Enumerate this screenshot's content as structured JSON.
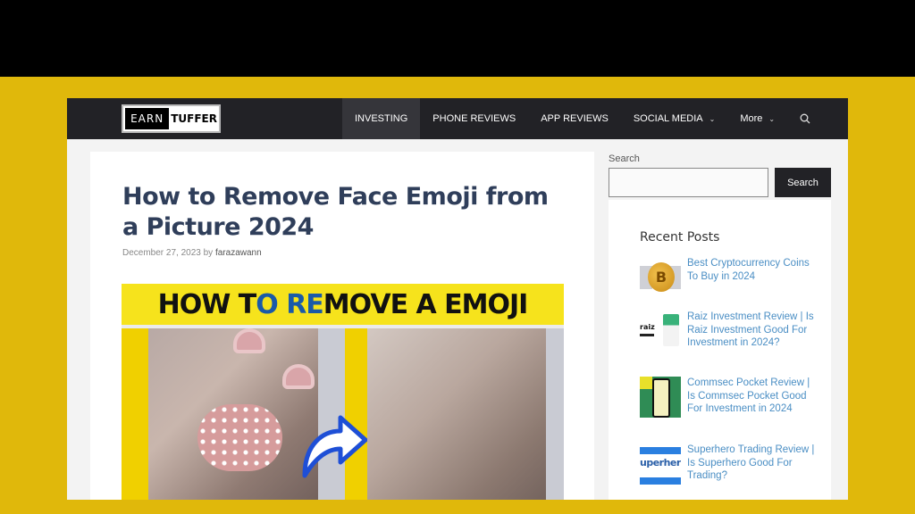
{
  "site": {
    "logo": {
      "part1": "EARN",
      "part2": "TUFFER"
    },
    "nav": [
      {
        "label": "INVESTING",
        "active": true,
        "has_dropdown": false
      },
      {
        "label": "PHONE REVIEWS",
        "active": false,
        "has_dropdown": false
      },
      {
        "label": "APP REVIEWS",
        "active": false,
        "has_dropdown": false
      },
      {
        "label": "SOCIAL MEDIA",
        "active": false,
        "has_dropdown": true
      },
      {
        "label": "More",
        "active": false,
        "has_dropdown": true
      }
    ],
    "nav_search_icon": "search-icon",
    "colors": {
      "header_bg": "#222226",
      "page_frame": "#e0b80b",
      "title": "#2f3e5a",
      "link": "#4a8ec4"
    }
  },
  "article": {
    "title": "How to Remove Face Emoji from a Picture 2024",
    "date": "December 27, 2023",
    "by": "by",
    "author": "farazawann",
    "featured_image": {
      "banner_pre": "HOW T",
      "banner_blue": "O RE",
      "banner_post": "MOVE A EMOJI"
    }
  },
  "sidebar": {
    "search_label": "Search",
    "search_value": "",
    "search_button": "Search",
    "recent_title": "Recent Posts",
    "posts": [
      {
        "title": "Best Cryptocurrency Coins To Buy in 2024",
        "thumb": "bitcoin"
      },
      {
        "title": "Raiz Investment Review | Is Raiz Investment Good For Investment in 2024?",
        "thumb": "raiz"
      },
      {
        "title": "Commsec Pocket Review | Is Commsec Pocket Good For Investment in 2024",
        "thumb": "commsec"
      },
      {
        "title": "Superhero Trading Review | Is Superhero Good For Trading?",
        "thumb": "superhero"
      }
    ],
    "thumb_text": {
      "btc": "B",
      "raiz": "raiz",
      "superhero": "uperher"
    }
  }
}
